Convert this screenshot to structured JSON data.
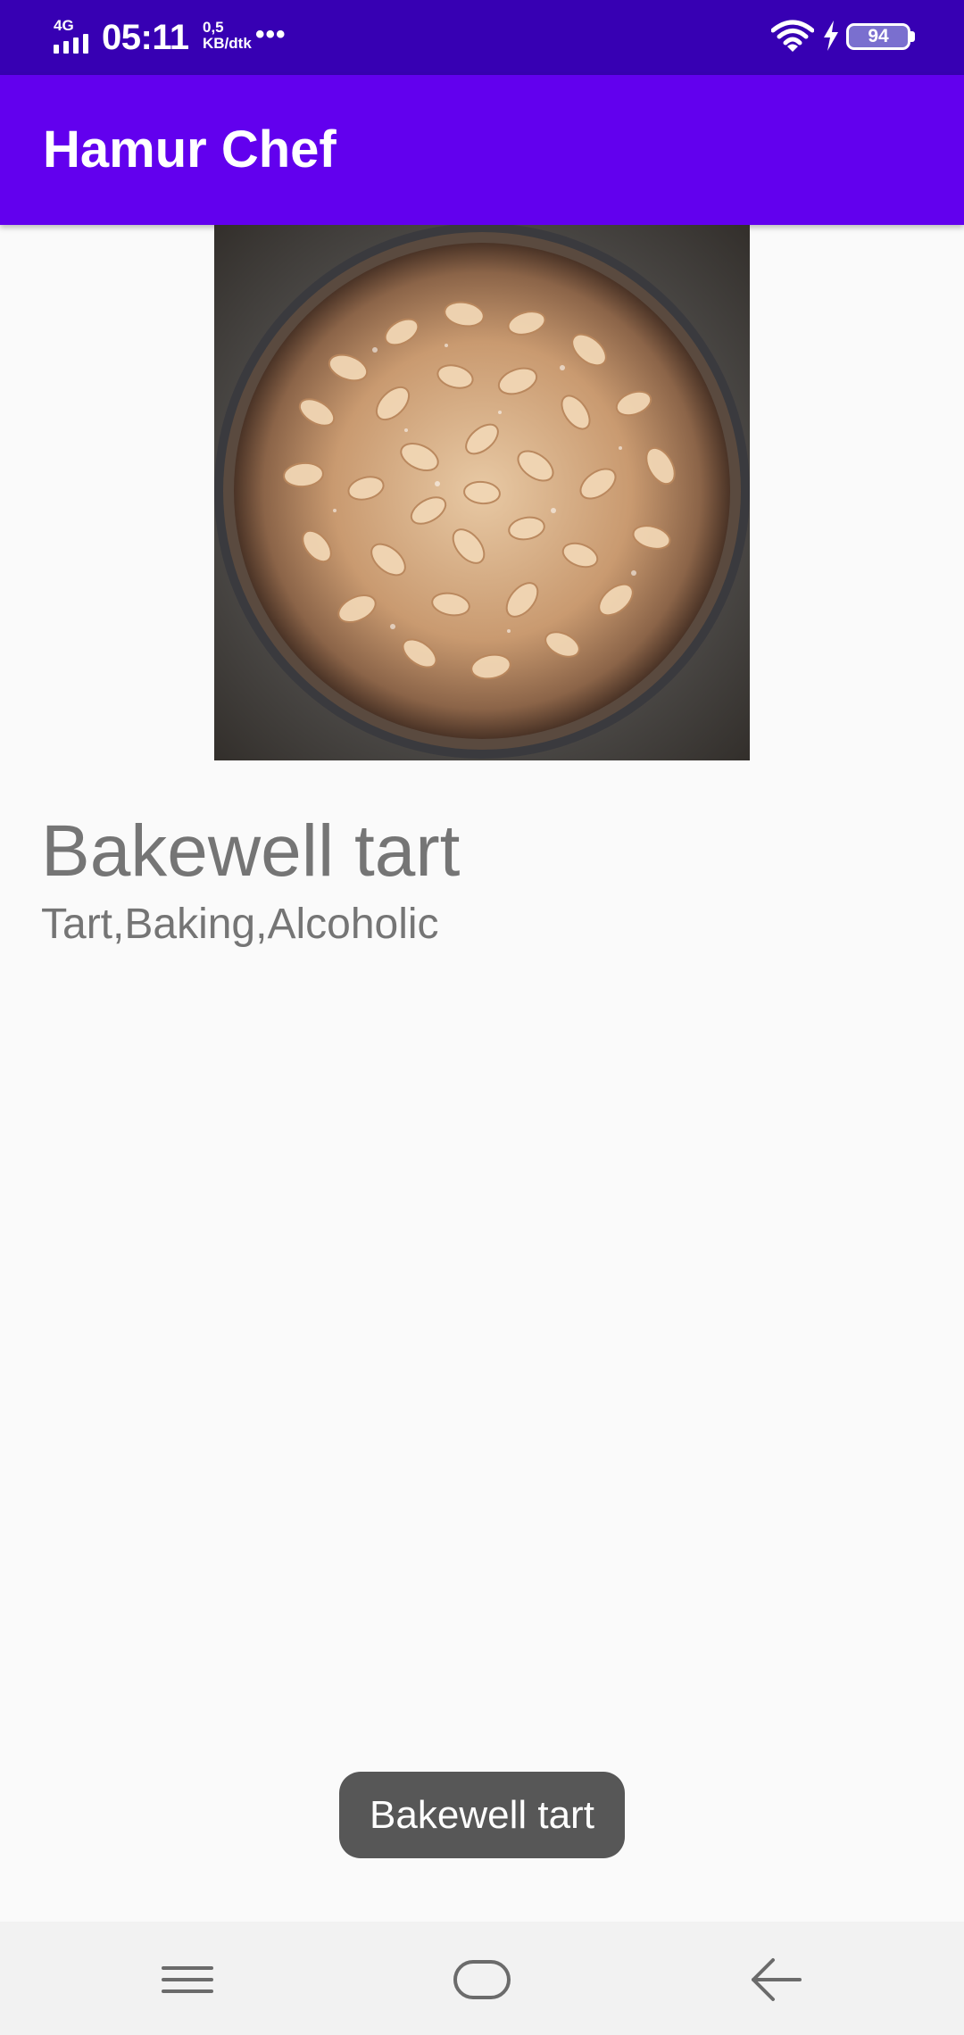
{
  "status_bar": {
    "network": "4G",
    "time": "05:11",
    "speed_value": "0,5",
    "speed_unit": "KB/dtk",
    "more": "•••",
    "battery": "94",
    "icons": [
      "signal-icon",
      "wifi-icon",
      "charging-icon",
      "battery-icon"
    ]
  },
  "app_bar": {
    "title": "Hamur Chef",
    "color": "#6200ee",
    "status_color": "#3700b3"
  },
  "recipe": {
    "image": "bakewell-tart-photo",
    "name": "Bakewell tart",
    "tags": "Tart,Baking,Alcoholic"
  },
  "toast": {
    "text": "Bakewell tart"
  },
  "nav_bar": {
    "icons": [
      "menu-icon",
      "home-icon",
      "back-icon"
    ]
  }
}
